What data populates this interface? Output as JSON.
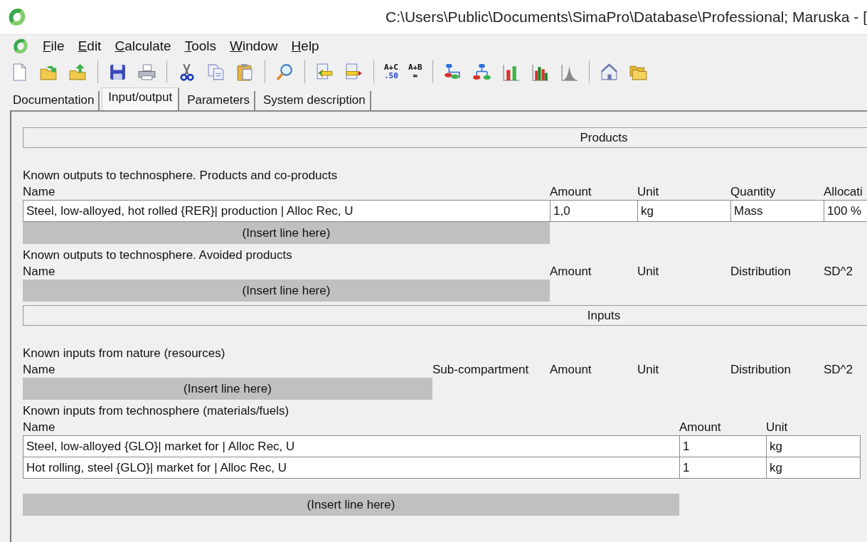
{
  "window": {
    "title": "C:\\Users\\Public\\Documents\\SimaPro\\Database\\Professional; Maruska - ["
  },
  "menu": [
    {
      "label": "File"
    },
    {
      "label": "Edit"
    },
    {
      "label": "Calculate"
    },
    {
      "label": "Tools"
    },
    {
      "label": "Window"
    },
    {
      "label": "Help"
    }
  ],
  "toolbar": {
    "text_buttons": [
      {
        "top": "A+C",
        "bottom": ".50",
        "color": "#1a3fd6"
      },
      {
        "top": "A+B",
        "bottom": "=",
        "color": "#000000"
      }
    ]
  },
  "tabs": [
    {
      "label": "Documentation",
      "selected": false
    },
    {
      "label": "Input/output",
      "selected": true
    },
    {
      "label": "Parameters",
      "selected": false
    },
    {
      "label": "System description",
      "selected": false
    }
  ],
  "sections": [
    {
      "kind": "header",
      "title": "Products"
    },
    {
      "kind": "output_table",
      "caption": "Known outputs to technosphere. Products and co-products",
      "columns": [
        "Name",
        "Amount",
        "Unit",
        "Quantity",
        "Allocati"
      ],
      "rows": [
        [
          "Steel, low-alloyed, hot rolled {RER}| production | Alloc Rec, U",
          "1,0",
          "kg",
          "Mass",
          "100 %"
        ]
      ],
      "insert": "(Insert line here)"
    },
    {
      "kind": "output_table",
      "caption": "Known outputs to technosphere. Avoided products",
      "columns": [
        "Name",
        "Amount",
        "Unit",
        "Distribution",
        "SD^2"
      ],
      "insert": "(Insert line here)"
    },
    {
      "kind": "header",
      "title": "Inputs"
    },
    {
      "kind": "resource_table",
      "caption": "Known inputs from nature (resources)",
      "columns": [
        "Name",
        "Sub-compartment",
        "Amount",
        "Unit",
        "Distribution",
        "SD^2"
      ],
      "insert": "(Insert line here)"
    },
    {
      "kind": "input_table",
      "caption": "Known inputs from technosphere (materials/fuels)",
      "columns": [
        "Name",
        "Amount",
        "Unit"
      ],
      "rows": [
        [
          "Steel, low-alloyed {GLO}| market for | Alloc Rec, U",
          "1",
          "kg"
        ],
        [
          "Hot rolling, steel {GLO}| market for | Alloc Rec, U",
          "1",
          "kg"
        ]
      ],
      "insert": "(Insert line here)"
    }
  ]
}
